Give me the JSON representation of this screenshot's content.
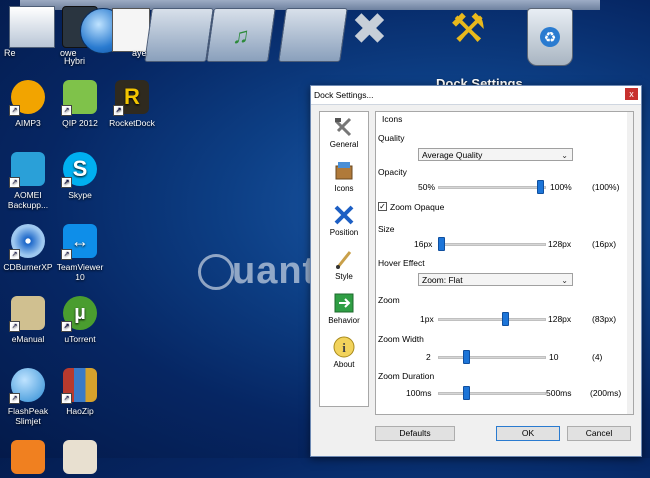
{
  "dock": {
    "title": "Dock Settings",
    "labels": [
      "Re",
      "owe",
      "Hybri",
      "aye"
    ]
  },
  "desktop": {
    "icons": [
      {
        "label": "AIMP3",
        "color": "#f2a400"
      },
      {
        "label": "QIP 2012",
        "color": "#7fc24a"
      },
      {
        "label": "RocketDock",
        "color": "#2f2a1f"
      },
      {
        "label": "AOMEI Backupp...",
        "color": "#2aa0d8"
      },
      {
        "label": "Skype",
        "color": "#00aff0"
      },
      {
        "label": "CDBurnerXP",
        "color": "#1b66c9"
      },
      {
        "label": "TeamViewer 10",
        "color": "#0e8ee9"
      },
      {
        "label": "eManual",
        "color": "#d0c090"
      },
      {
        "label": "uTorrent",
        "color": "#4a9d2f"
      },
      {
        "label": "FlashPeak Slimjet",
        "color": "#2d8cd4"
      },
      {
        "label": "HaoZip",
        "color": "#b83a2e"
      }
    ]
  },
  "dialog": {
    "title": "Dock Settings...",
    "close": "x",
    "nav": [
      {
        "label": "General",
        "icon": "tools-icon"
      },
      {
        "label": "Icons",
        "icon": "box-icon"
      },
      {
        "label": "Position",
        "icon": "arrows-icon"
      },
      {
        "label": "Style",
        "icon": "brush-icon"
      },
      {
        "label": "Behavior",
        "icon": "behavior-icon"
      },
      {
        "label": "About",
        "icon": "info-icon"
      }
    ],
    "section_title": "Icons",
    "quality": {
      "label": "Quality",
      "value": "Average Quality"
    },
    "opacity": {
      "label": "Opacity",
      "min": "50%",
      "max": "100%",
      "current": "(100%)",
      "value": 100
    },
    "zoom_opaque": {
      "label": "Zoom Opaque",
      "checked": true
    },
    "size": {
      "label": "Size",
      "min": "16px",
      "max": "128px",
      "current": "(16px)",
      "value": 16
    },
    "hover_effect": {
      "label": "Hover Effect",
      "value": "Zoom: Flat"
    },
    "zoom": {
      "label": "Zoom",
      "min": "1px",
      "max": "128px",
      "current": "(83px)",
      "value": 83
    },
    "zoom_width": {
      "label": "Zoom Width",
      "min": "2",
      "max": "10",
      "current": "(4)",
      "value": 4
    },
    "zoom_duration": {
      "label": "Zoom Duration",
      "min": "100ms",
      "max": "500ms",
      "current": "(200ms)",
      "value": 200
    },
    "buttons": {
      "defaults": "Defaults",
      "ok": "OK",
      "cancel": "Cancel"
    }
  },
  "watermark": "uantrimang"
}
